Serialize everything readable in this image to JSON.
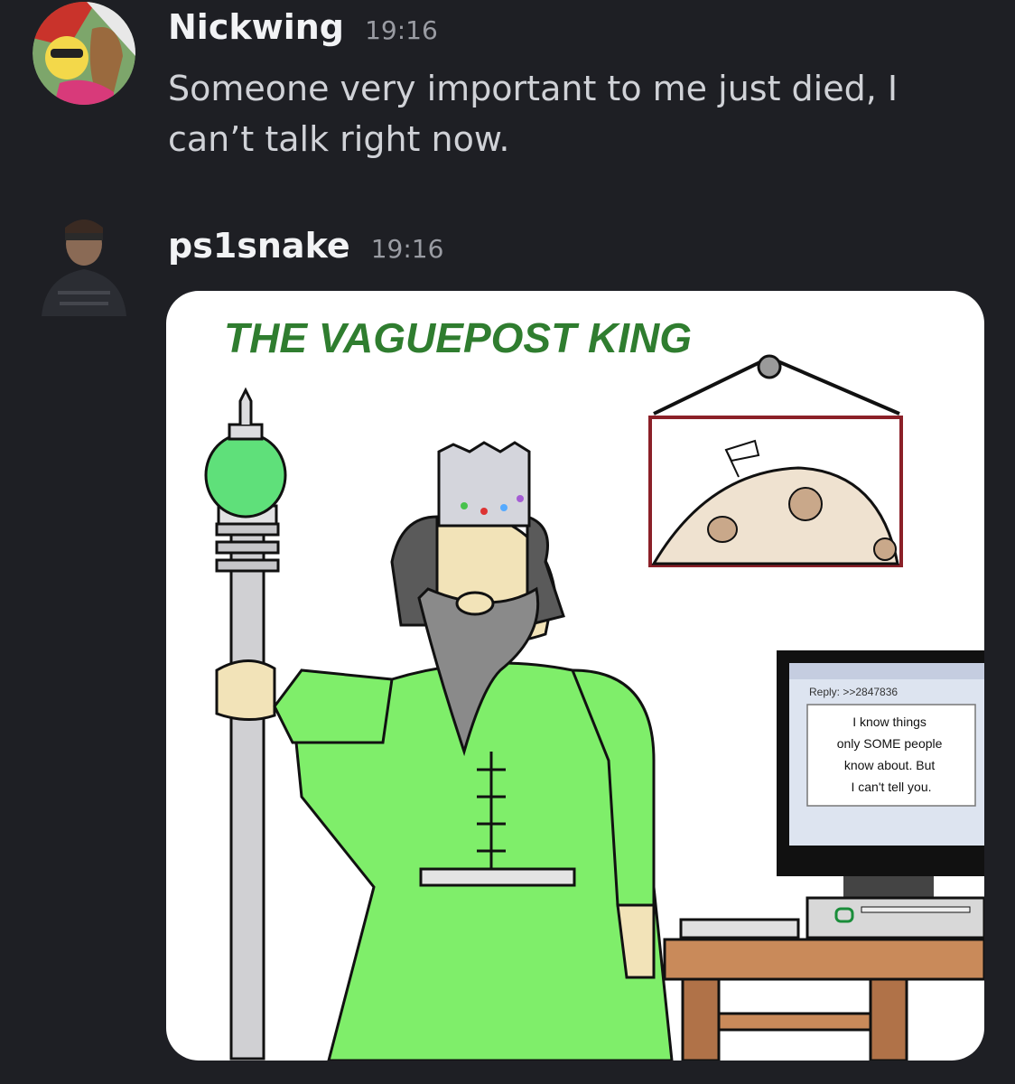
{
  "messages": [
    {
      "username": "Nickwing",
      "timestamp": "19:16",
      "text": "Someone very important to me just died, I can’t talk right now.",
      "avatar_icon": "cartoon-characters-avatar"
    },
    {
      "username": "ps1snake",
      "timestamp": "19:16",
      "avatar_icon": "snake-character-avatar",
      "attachment": {
        "title": "THE VAGUEPOST KING",
        "screen_reply": "Reply: >>2847836",
        "screen_lines": [
          "I know things",
          "only SOME people",
          "know about. But",
          "I can't tell you."
        ]
      }
    }
  ],
  "colors": {
    "background": "#1e1f24",
    "username": "#f2f3f5",
    "text": "#d0d2d7",
    "timestamp": "#9a9ca3",
    "title_green": "#2f7d2f",
    "robe_green": "#7fee6a"
  }
}
